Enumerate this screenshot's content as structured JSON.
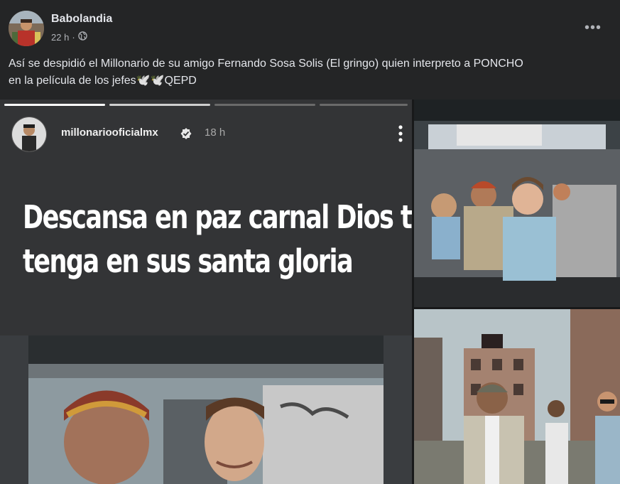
{
  "post": {
    "author": "Babolandia",
    "time": "22 h",
    "separator": "·",
    "audience_icon": "globe-icon",
    "more_icon": "more-dots-icon",
    "more_label": "•••",
    "caption_line1": "Así se despidió el Millonario de su amigo Fernando Sosa Solis  (El gringo) quien interpreto a PONCHO",
    "caption_line2": "en la película de los jefes🕊️🕊️QEPD"
  },
  "story": {
    "username": "millonariooficialmx",
    "verified_icon": "verified-badge-icon",
    "time": "18 h",
    "menu_icon": "vertical-dots-icon",
    "text_line1": "Descansa en paz carnal Dios te",
    "text_line2": "tenga en sus santa gloria",
    "progress_segments": [
      {
        "state": "done"
      },
      {
        "state": "active"
      },
      {
        "state": "pending"
      },
      {
        "state": "pending"
      }
    ]
  },
  "colors": {
    "background": "#242526",
    "text_primary": "#e4e6eb",
    "text_secondary": "#b0b3b8",
    "story_bg": "#333436"
  }
}
